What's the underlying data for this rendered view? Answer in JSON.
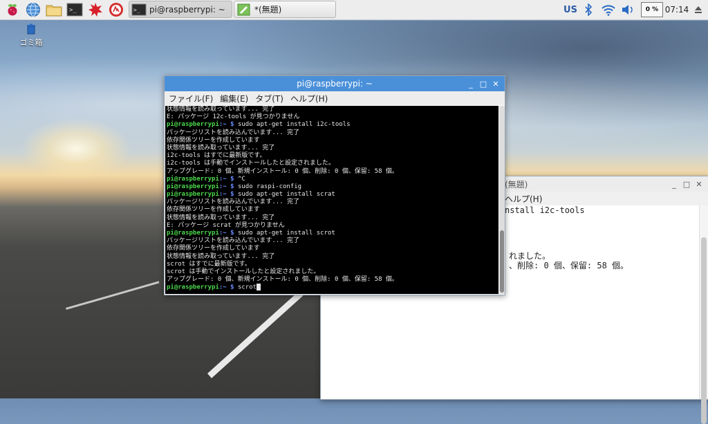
{
  "desktop": {
    "trash_label": "ゴミ箱"
  },
  "taskbar": {
    "launchers": [
      "raspberry-menu",
      "web-browser",
      "file-manager",
      "terminal",
      "mathematica",
      "wolfram"
    ],
    "tasks": [
      {
        "label": "pi@raspberrypi: ~",
        "active": true
      },
      {
        "label": "*(無題)",
        "active": false
      }
    ],
    "tray": {
      "keyboard_layout": "US",
      "cpu_usage": "0 %",
      "clock": "07:14"
    }
  },
  "terminal": {
    "title": "pi@raspberrypi: ~",
    "menu": [
      "ファイル(F)",
      "編集(E)",
      "タブ(T)",
      "ヘルプ(H)"
    ],
    "lines": [
      {
        "text": "状態情報を読み取っています... 完了"
      },
      {
        "text": "E: パッケージ 12c-tools が見つかりません"
      },
      {
        "prompt": "pi@raspberrypi",
        "path": ":~ $",
        "cmd": " sudo apt-get install i2c-tools"
      },
      {
        "text": "パッケージリストを読み込んでいます... 完了"
      },
      {
        "text": "依存関係ツリーを作成しています"
      },
      {
        "text": "状態情報を読み取っています... 完了"
      },
      {
        "text": "i2c-tools はすでに最新版です。"
      },
      {
        "text": "i2c-tools は手動でインストールしたと設定されました。"
      },
      {
        "text": "アップグレード: 0 個、新規インストール: 0 個、削除: 0 個、保留: 58 個。"
      },
      {
        "prompt": "pi@raspberrypi",
        "path": ":~ $",
        "cmd": " ^C"
      },
      {
        "prompt": "pi@raspberrypi",
        "path": ":~ $",
        "cmd": " sudo raspi-config"
      },
      {
        "prompt": "pi@raspberrypi",
        "path": ":~ $",
        "cmd": " sudo apt-get install scrat"
      },
      {
        "text": "パッケージリストを読み込んでいます... 完了"
      },
      {
        "text": "依存関係ツリーを作成しています"
      },
      {
        "text": "状態情報を読み取っています... 完了"
      },
      {
        "text": "E: パッケージ scrat が見つかりません"
      },
      {
        "prompt": "pi@raspberrypi",
        "path": ":~ $",
        "cmd": " sudo apt-get install scrot"
      },
      {
        "text": "パッケージリストを読み込んでいます... 完了"
      },
      {
        "text": "依存関係ツリーを作成しています"
      },
      {
        "text": "状態情報を読み取っています... 完了"
      },
      {
        "text": "scrot はすでに最新版です。"
      },
      {
        "text": "scrot は手動でインストールしたと設定されました。"
      },
      {
        "text": "アップグレード: 0 個、新規インストール: 0 個、削除: 0 個、保留: 58 個。"
      },
      {
        "prompt": "pi@raspberrypi",
        "path": ":~ $",
        "cmd": " scrot",
        "cursor": true
      }
    ]
  },
  "editor": {
    "title": "(無題)",
    "menu_partial": "ヘルプ(H)",
    "lines": [
      "nstall i2c-tools",
      "れました。",
      "、削除: 0 個、保留: 58 個。"
    ]
  },
  "colors": {
    "terminal_titlebar": "#4a90d9",
    "prompt_green": "#4cd84c",
    "path_blue": "#6a8cff"
  }
}
